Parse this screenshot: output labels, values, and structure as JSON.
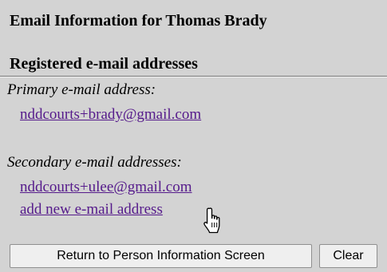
{
  "page": {
    "title": "Email Information for Thomas Brady"
  },
  "emails": {
    "section_heading": "Registered e-mail addresses",
    "primary_label": "Primary e-mail address:",
    "primary_email": "nddcourts+brady@gmail.com",
    "secondary_label": "Secondary e-mail addresses:",
    "secondary_emails": [
      "nddcourts+ulee@gmail.com"
    ],
    "add_new_label": "add new e-mail address"
  },
  "actions": {
    "return_label": "Return to Person Information Screen",
    "clear_label": "Clear"
  },
  "colors": {
    "background": "#d3d3d3",
    "link": "#551a8b"
  },
  "icons": {
    "cursor": "hand-pointer-icon"
  }
}
